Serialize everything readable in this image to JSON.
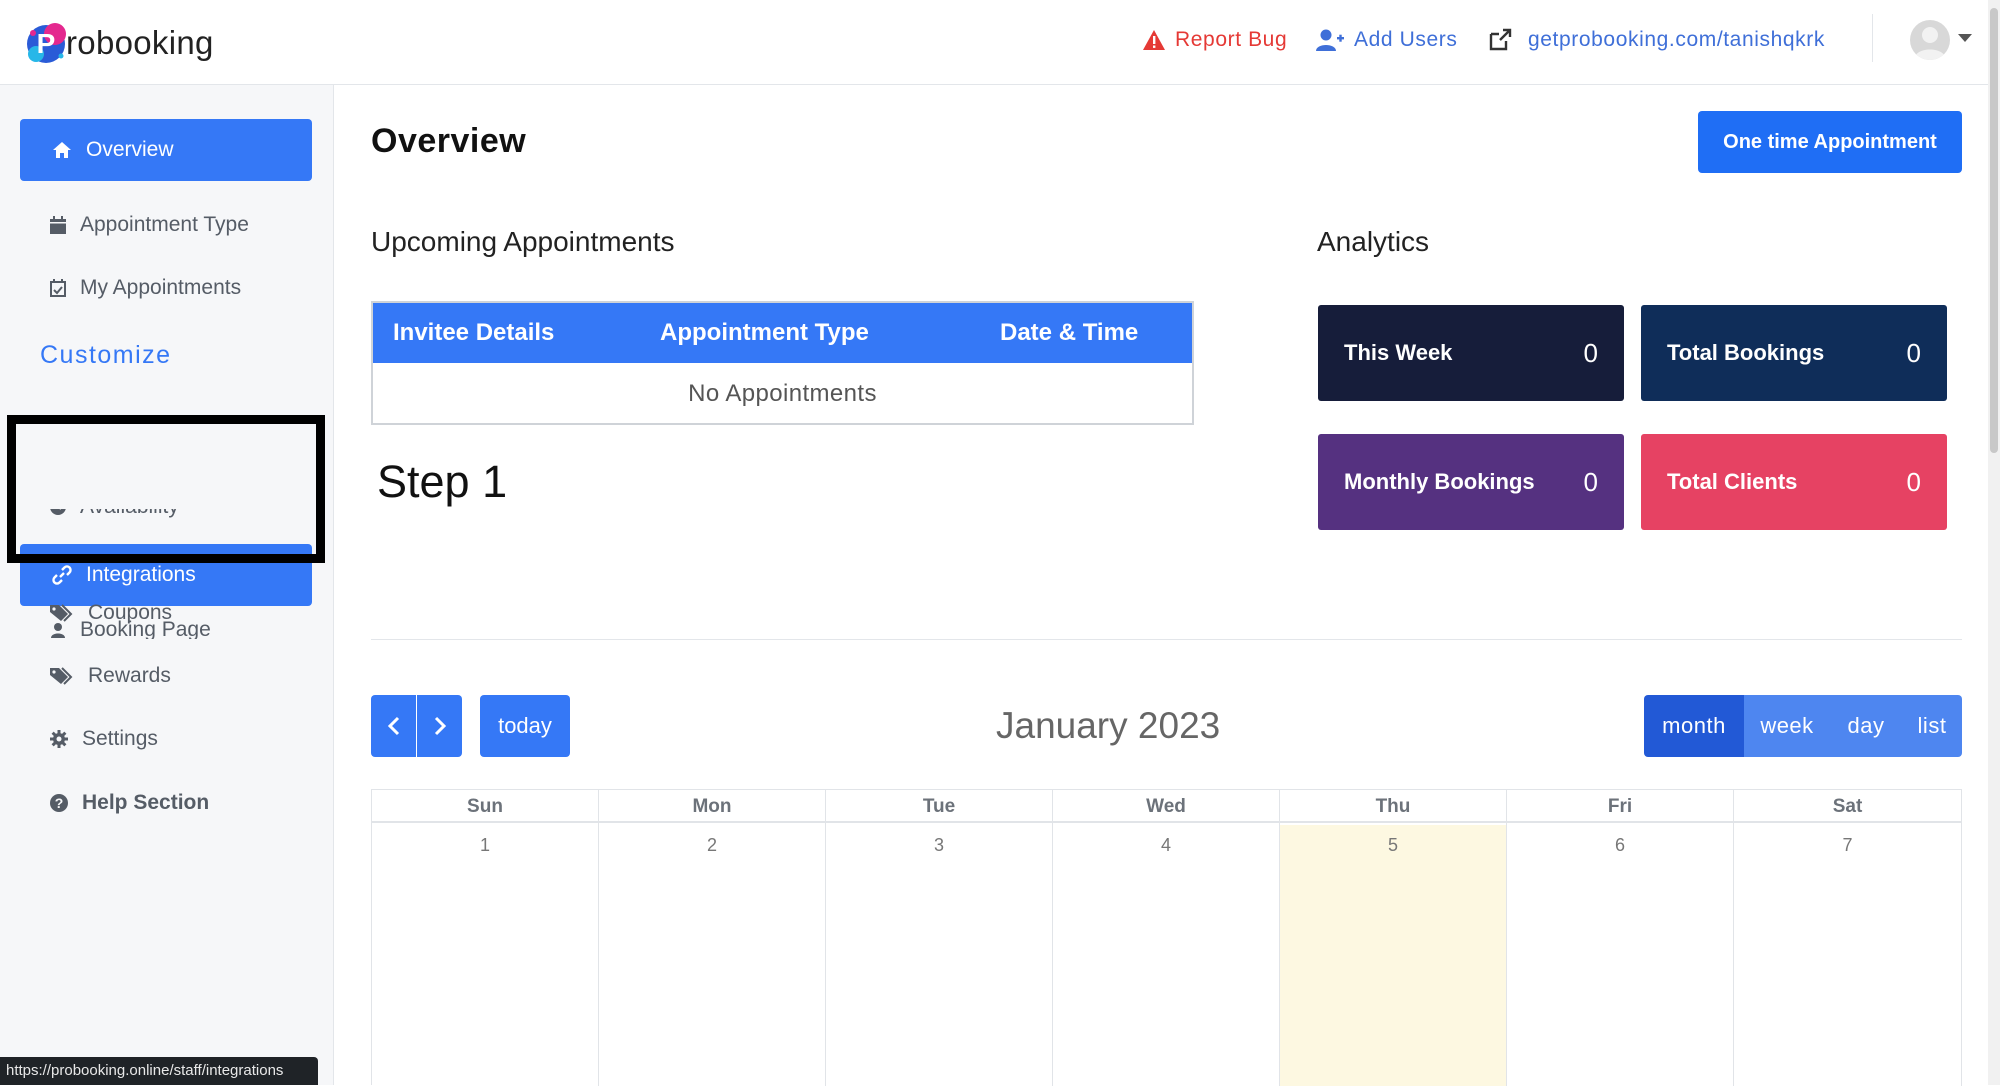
{
  "brand": {
    "name_rest": "robooking",
    "letter": "P"
  },
  "header": {
    "report_bug": "Report Bug",
    "add_users": "Add Users",
    "link": "getprobooking.com/tanishqkrk"
  },
  "sidebar": {
    "overview": "Overview",
    "appointment_type": "Appointment Type",
    "my_appointments": "My Appointments",
    "customize": "Customize",
    "availability": "Availability",
    "integrations": "Integrations",
    "booking_page": "Booking Page",
    "coupons": "Coupons",
    "rewards": "Rewards",
    "settings": "Settings",
    "help": "Help Section"
  },
  "status_url": "https://probooking.online/staff/integrations",
  "main": {
    "title": "Overview",
    "one_time_button": "One time Appointment",
    "upcoming_title": "Upcoming Appointments",
    "table_headers": [
      "Invitee Details",
      "Appointment Type",
      "Date & Time"
    ],
    "empty_text": "No Appointments",
    "step": "Step 1",
    "analytics_title": "Analytics",
    "cards": [
      {
        "label": "This Week",
        "value": "0",
        "color": "#161d3a"
      },
      {
        "label": "Total Bookings",
        "value": "0",
        "color": "#0f2d59"
      },
      {
        "label": "Monthly Bookings",
        "value": "0",
        "color": "#553180"
      },
      {
        "label": "Total Clients",
        "value": "0",
        "color": "#e64263"
      }
    ]
  },
  "calendar": {
    "title": "January 2023",
    "today": "today",
    "views": [
      "month",
      "week",
      "day",
      "list"
    ],
    "active_view": "month",
    "days_of_week": [
      "Sun",
      "Mon",
      "Tue",
      "Wed",
      "Thu",
      "Fri",
      "Sat"
    ],
    "dates": [
      "1",
      "2",
      "3",
      "4",
      "5",
      "6",
      "7"
    ],
    "today_date": "5"
  }
}
